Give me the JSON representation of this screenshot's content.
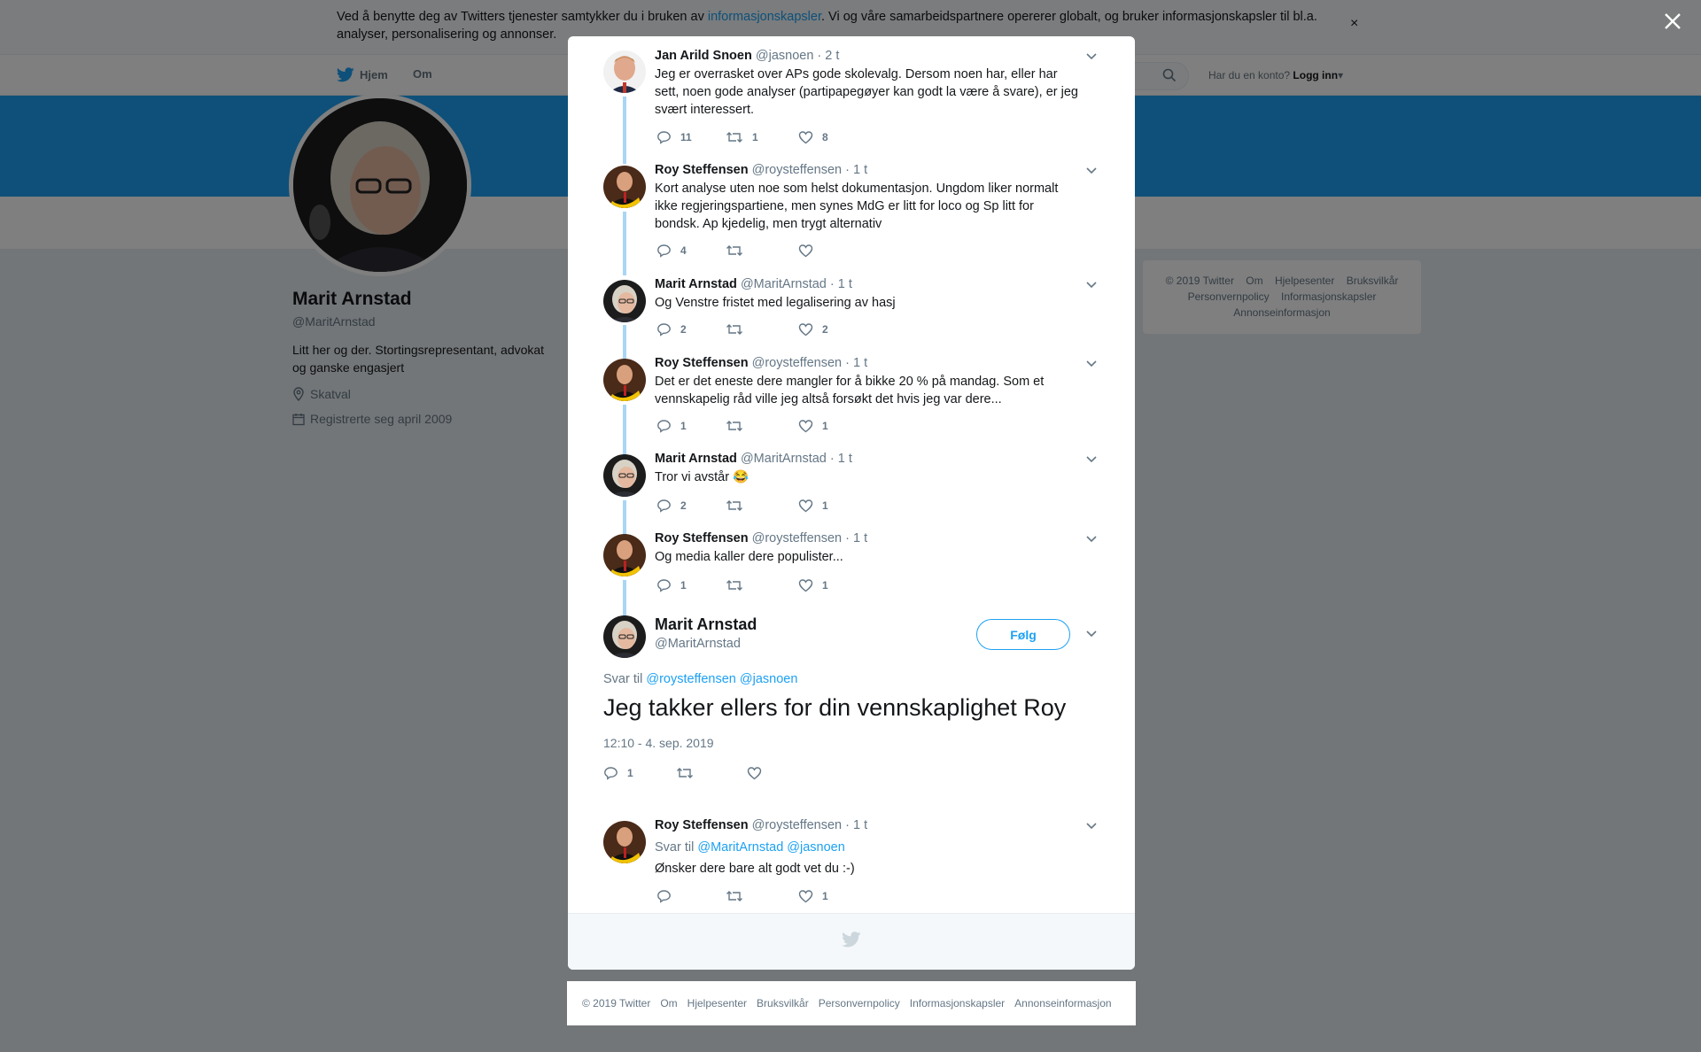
{
  "cookie": {
    "before": "Ved å benytte deg av Twitters tjenester samtykker du i bruken av ",
    "link": "informasjonskapsler",
    "after": ". Vi og våre samarbeidspartnere opererer globalt, og bruker informasjonskapsler til bl.a. analyser, personalisering og annonser.",
    "close": "×"
  },
  "nav": {
    "home": "Hjem",
    "about": "Om",
    "login_prompt": "Har du en konto?",
    "login": "Logg inn"
  },
  "profile": {
    "name": "Marit Arnstad",
    "handle": "@MaritArnstad",
    "bio": "Litt her og der. Stortingsrepresentant, advokat og ganske engasjert",
    "location": "Skatval",
    "joined": "Registrerte seg april 2009"
  },
  "side_footer": [
    "© 2019 Twitter",
    "Om",
    "Hjelpesenter",
    "Bruksvilkår",
    "Personvernpolicy",
    "Informasjonskapsler",
    "Annonseinformasjon"
  ],
  "tweets": [
    {
      "name": "Jan Arild Snoen",
      "handle": "@jasnoen",
      "time": "· 2 t",
      "text": "Jeg er overrasket over APs gode skolevalg. Dersom noen har, eller har sett, noen gode analyser (partipapegøyer kan godt la være å svare), er jeg svært interessert.",
      "replies": "11",
      "retweets": "1",
      "likes": "8"
    },
    {
      "name": "Roy Steffensen",
      "handle": "@roysteffensen",
      "time": "· 1 t",
      "text": "Kort analyse uten noe som helst dokumentasjon. Ungdom liker normalt ikke regjeringspartiene, men synes MdG er litt for loco og Sp litt for bondsk. Ap kjedelig, men trygt alternativ",
      "replies": "4",
      "retweets": "",
      "likes": ""
    },
    {
      "name": "Marit Arnstad",
      "handle": "@MaritArnstad",
      "time": "· 1 t",
      "text": "Og Venstre fristet med legalisering av hasj",
      "replies": "2",
      "retweets": "",
      "likes": "2"
    },
    {
      "name": "Roy Steffensen",
      "handle": "@roysteffensen",
      "time": "· 1 t",
      "text": "Det er det eneste dere mangler for å bikke 20 % på mandag. Som et vennskapelig råd ville jeg altså forsøkt det hvis jeg var dere...",
      "replies": "1",
      "retweets": "",
      "likes": "1"
    },
    {
      "name": "Marit Arnstad",
      "handle": "@MaritArnstad",
      "time": "· 1 t",
      "text": "Tror vi avstår 😂",
      "replies": "2",
      "retweets": "",
      "likes": "1"
    },
    {
      "name": "Roy Steffensen",
      "handle": "@roysteffensen",
      "time": "· 1 t",
      "text": "Og media kaller dere populister...",
      "replies": "1",
      "retweets": "",
      "likes": "1"
    }
  ],
  "main_tweet": {
    "name": "Marit Arnstad",
    "handle": "@MaritArnstad",
    "follow": "Følg",
    "reply_prefix": "Svar til",
    "reply_users": "@roysteffensen @jasnoen",
    "text": "Jeg takker ellers for din vennskaplighet Roy",
    "date": "12:10 - 4. sep. 2019",
    "replies": "1",
    "retweets": "",
    "likes": ""
  },
  "reply_tweet": {
    "name": "Roy Steffensen",
    "handle": "@roysteffensen",
    "time": "· 1 t",
    "reply_prefix": "Svar til",
    "reply_users": "@MaritArnstad @jasnoen",
    "text": "Ønsker dere bare alt godt vet du :-)",
    "replies": "",
    "retweets": "",
    "likes": "1"
  },
  "page_footer": [
    "© 2019 Twitter",
    "Om",
    "Hjelpesenter",
    "Bruksvilkår",
    "Personvernpolicy",
    "Informasjonskapsler",
    "Annonseinformasjon"
  ],
  "colors": {
    "accent": "#1da1f2",
    "thread_line": "#a9d6f5",
    "muted": "#657786"
  },
  "icons": [
    "twitter-bird-icon",
    "search-icon",
    "close-icon",
    "location-icon",
    "calendar-icon",
    "reply-icon",
    "retweet-icon",
    "heart-icon",
    "chevron-down-icon"
  ]
}
